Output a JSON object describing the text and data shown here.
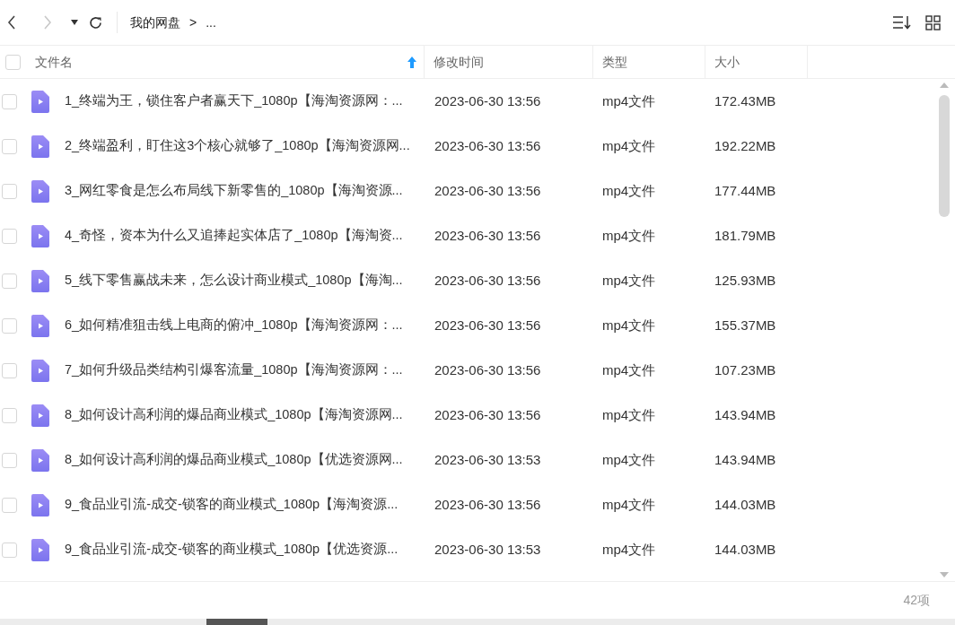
{
  "toolbar": {
    "breadcrumb": [
      "我的网盘",
      ">",
      "..."
    ]
  },
  "table": {
    "select_all": {
      "checked": false
    },
    "columns": [
      "文件名",
      "修改时间",
      "类型",
      "大小"
    ],
    "rows": [
      {
        "checked": false,
        "name": "1_终端为王，锁住客户者赢天下_1080p【海淘资源网：...",
        "modified": "2023-06-30 13:56",
        "type": "mp4文件",
        "size": "172.43MB"
      },
      {
        "checked": false,
        "name": "2_终端盈利，盯住这3个核心就够了_1080p【海淘资源网...",
        "modified": "2023-06-30 13:56",
        "type": "mp4文件",
        "size": "192.22MB"
      },
      {
        "checked": false,
        "name": "3_网红零食是怎么布局线下新零售的_1080p【海淘资源...",
        "modified": "2023-06-30 13:56",
        "type": "mp4文件",
        "size": "177.44MB"
      },
      {
        "checked": false,
        "name": "4_奇怪，资本为什么又追捧起实体店了_1080p【海淘资...",
        "modified": "2023-06-30 13:56",
        "type": "mp4文件",
        "size": "181.79MB"
      },
      {
        "checked": false,
        "name": "5_线下零售赢战未来，怎么设计商业模式_1080p【海淘...",
        "modified": "2023-06-30 13:56",
        "type": "mp4文件",
        "size": "125.93MB"
      },
      {
        "checked": false,
        "name": "6_如何精准狙击线上电商的俯冲_1080p【海淘资源网：...",
        "modified": "2023-06-30 13:56",
        "type": "mp4文件",
        "size": "155.37MB"
      },
      {
        "checked": false,
        "name": "7_如何升级品类结构引爆客流量_1080p【海淘资源网：...",
        "modified": "2023-06-30 13:56",
        "type": "mp4文件",
        "size": "107.23MB"
      },
      {
        "checked": false,
        "name": "8_如何设计高利润的爆品商业模式_1080p【海淘资源网...",
        "modified": "2023-06-30 13:56",
        "type": "mp4文件",
        "size": "143.94MB"
      },
      {
        "checked": false,
        "name": "8_如何设计高利润的爆品商业模式_1080p【优选资源网...",
        "modified": "2023-06-30 13:53",
        "type": "mp4文件",
        "size": "143.94MB"
      },
      {
        "checked": false,
        "name": "9_食品业引流-成交-锁客的商业模式_1080p【海淘资源...",
        "modified": "2023-06-30 13:56",
        "type": "mp4文件",
        "size": "144.03MB"
      },
      {
        "checked": false,
        "name": "9_食品业引流-成交-锁客的商业模式_1080p【优选资源...",
        "modified": "2023-06-30 13:53",
        "type": "mp4文件",
        "size": "144.03MB"
      }
    ]
  },
  "status_bar": {
    "count": "42项"
  }
}
